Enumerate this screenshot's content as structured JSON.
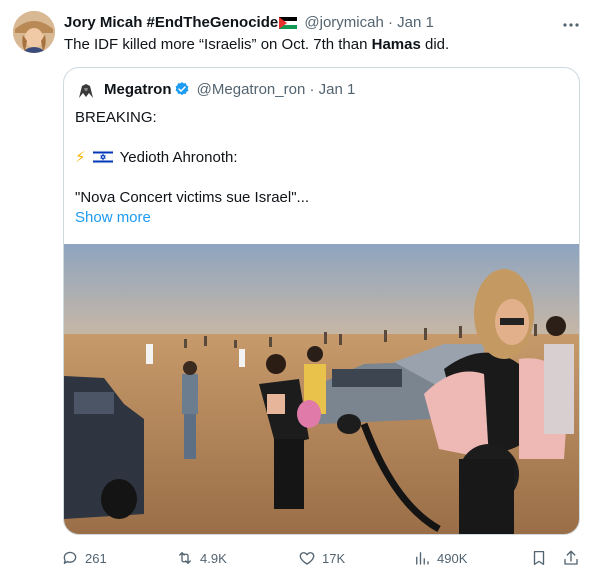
{
  "tweet": {
    "author_name": "Jory Micah #EndTheGenocide",
    "handle": "@jorymicah",
    "separator": "·",
    "date": "Jan 1",
    "text_part1": "The IDF killed more “Israelis” on Oct. 7th than ",
    "text_bold": "Hamas",
    "text_part2": " did."
  },
  "quoted": {
    "author_name": "Megatron",
    "handle": "@Megatron_ron",
    "separator": "·",
    "date": "Jan 1",
    "line1": "BREAKING:",
    "line2_emoji": "⚡",
    "line2_text": "Yedioth Ahronoth:",
    "line3": "\"Nova Concert victims sue Israel\"...",
    "show_more": "Show more"
  },
  "actions": {
    "replies": "261",
    "reposts": "4.9K",
    "likes": "17K",
    "views": "490K"
  },
  "icons": [
    "more-icon",
    "verified-icon",
    "reply-icon",
    "repost-icon",
    "like-icon",
    "views-icon",
    "bookmark-icon",
    "share-icon"
  ],
  "colors": {
    "accent": "#1d9bf0",
    "muted": "#536471",
    "border": "#cfd9de"
  }
}
